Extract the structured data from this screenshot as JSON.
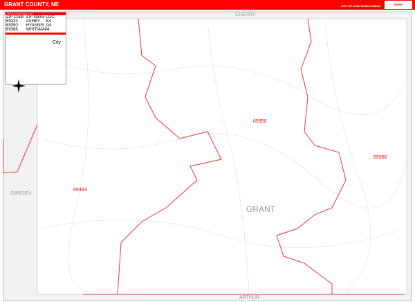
{
  "header": {
    "title": "GRANT COUNTY, NE",
    "edition": "2026 ZIP Code Redline Edition",
    "logo": "MAPS"
  },
  "neighbors": {
    "north": "CHERRY",
    "south": "ARTHUR",
    "west": "GARDEN"
  },
  "county_label": "GRANT",
  "zip_labels": [
    "69350",
    "69366",
    "69333"
  ],
  "legend": {
    "title": "ZIP Code Index/Grid Locator",
    "columns": [
      "ZIP Code",
      "ZIP Name",
      "LOC"
    ],
    "rows": [
      [
        "69333",
        "ASHBY",
        "E4"
      ],
      [
        "69350",
        "HYANNIS",
        "G4"
      ],
      [
        "69366",
        "WHITMAN",
        "I4"
      ]
    ],
    "city_label": "City"
  },
  "colors": {
    "accent": "#ff0000",
    "boundary": "#ee3333",
    "road": "#cccccc"
  }
}
